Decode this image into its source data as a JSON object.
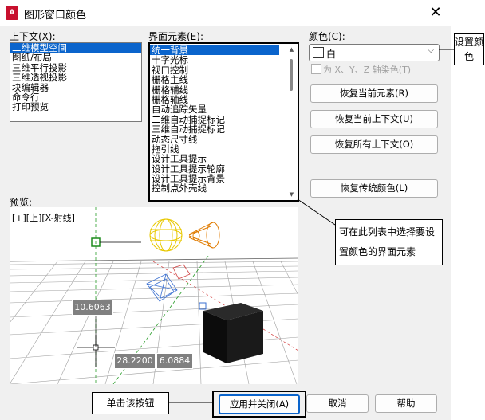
{
  "window": {
    "title": "图形窗口颜色",
    "app_icon": "A"
  },
  "context": {
    "label": "上下文(X):",
    "items": [
      "二维模型空间",
      "图纸/布局",
      "三维平行投影",
      "三维透视投影",
      "块编辑器",
      "命令行",
      "打印预览"
    ]
  },
  "interface": {
    "label": "界面元素(E):",
    "items": [
      "统一背景",
      "十字光标",
      "视口控制",
      "栅格主线",
      "栅格辅线",
      "栅格轴线",
      "自动追踪矢量",
      "二维自动捕捉标记",
      "三维自动捕捉标记",
      "动态尺寸线",
      "拖引线",
      "设计工具提示",
      "设计工具提示轮廓",
      "设计工具提示背景",
      "控制点外壳线"
    ]
  },
  "color": {
    "label": "颜色(C):",
    "selected": "白",
    "tint_checkbox": "为 X、Y、Z 轴染色(T)"
  },
  "buttons": {
    "restore_element": "恢复当前元素(R)",
    "restore_context": "恢复当前上下文(U)",
    "restore_all": "恢复所有上下文(O)",
    "restore_classic": "恢复传统颜色(L)",
    "apply_close": "应用并关闭(A)",
    "cancel": "取消",
    "help": "帮助"
  },
  "preview": {
    "label": "预览:",
    "viewport_label": "[+][上][X-射线]",
    "dim_length": "10.6063",
    "coord_x": "28.2200",
    "coord_y": "6.0884"
  },
  "annotations": {
    "set_color": "设置颜色",
    "select_element": "可在此列表中选择要设置颜色的界面元素",
    "click_button": "单击该按钮"
  },
  "colors": {
    "selection": "#0a64cc",
    "accent_red": "#c8102e",
    "wire_yellow": "#e8c800",
    "wire_orange": "#e07b00"
  }
}
